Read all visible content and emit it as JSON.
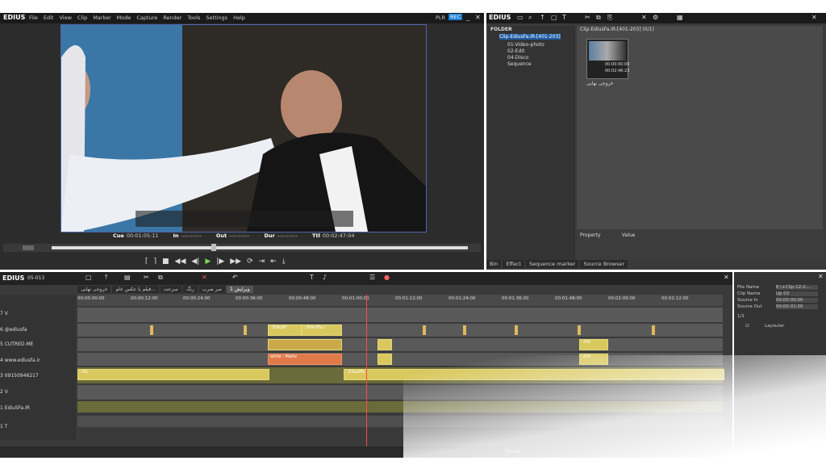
{
  "app": {
    "logo": "EDIUS",
    "menu": [
      "File",
      "Edit",
      "View",
      "Clip",
      "Marker",
      "Mode",
      "Capture",
      "Render",
      "Tools",
      "Settings",
      "Help"
    ],
    "plr": "PLR",
    "rec": "REC"
  },
  "player": {
    "timecodes": [
      {
        "label": "Cue",
        "value": "00:01:05:11"
      },
      {
        "label": "In",
        "value": "--:--:--:--"
      },
      {
        "label": "Out",
        "value": "--:--:--:--"
      },
      {
        "label": "Dur",
        "value": "--:--:--:--"
      },
      {
        "label": "Ttl",
        "value": "00:02:47:04"
      }
    ]
  },
  "bin": {
    "logo": "EDIUS",
    "folder_label": "FOLDER",
    "tree": [
      "Clip-EdiusFa.iR-[401-203]",
      "01-Video-photo",
      "02-Edit",
      "04-Disco",
      "Sequence"
    ],
    "clip_path": "Clip-EdiusFa.iR-[401-203] (0/1)",
    "thumb_label": "خروجی نهایی",
    "thumb_tc1": "00:00:00:00",
    "thumb_tc2": "00:02:46:23",
    "prop_header": "Property",
    "value_header": "Value",
    "tabs": [
      "Bin",
      "Effect",
      "Sequence marker",
      "Source Browser"
    ]
  },
  "timeline": {
    "logo": "EDIUS",
    "seq_id": "05-013",
    "seq_tabs": [
      "خروجی نهایی",
      "فیلم یا عکس خام...",
      "سرعت",
      "رنگ",
      "سر ضرب",
      "ویرایش 1"
    ],
    "ruler": [
      "00:00:00:00",
      "00:00:12:00",
      "00:00:24:00",
      "00:00:36:00",
      "00:00:48:00",
      "00:01:00:00",
      "00:01:12:00",
      "00:01:24:00",
      "00:01:36:00",
      "00:01:48:00",
      "00:02:00:00",
      "00:02:12:00"
    ],
    "tracks": [
      {
        "name": "7 V"
      },
      {
        "name": "6 @ediusfa"
      },
      {
        "name": "5 CUTRED.ME"
      },
      {
        "name": "4 www.ediusfa.ir"
      },
      {
        "name": "3 09150946217"
      },
      {
        "name": "2 V"
      },
      {
        "name": "1 EdiuSFa.IR"
      },
      {
        "name": "1 T"
      }
    ],
    "clip_labels": {
      "edius_a": "::EdiuSF",
      "edius_b": "::EdiuSFa.I",
      "white_matte": "white - Matte",
      "edius_c": "::Edi",
      "edius_d": "::Ed",
      "edius_e": "::EdiuSFa"
    },
    "status": "Pause"
  },
  "info": {
    "rows": [
      {
        "label": "File Name",
        "value": "E:\\+Clip-12-2-..."
      },
      {
        "label": "Clip Name",
        "value": "Up 03"
      },
      {
        "label": "Source In",
        "value": "00:00:00:00"
      },
      {
        "label": "Source Out",
        "value": "00:00:01:00"
      }
    ],
    "page": "1/1",
    "layouter": "Layouter"
  }
}
